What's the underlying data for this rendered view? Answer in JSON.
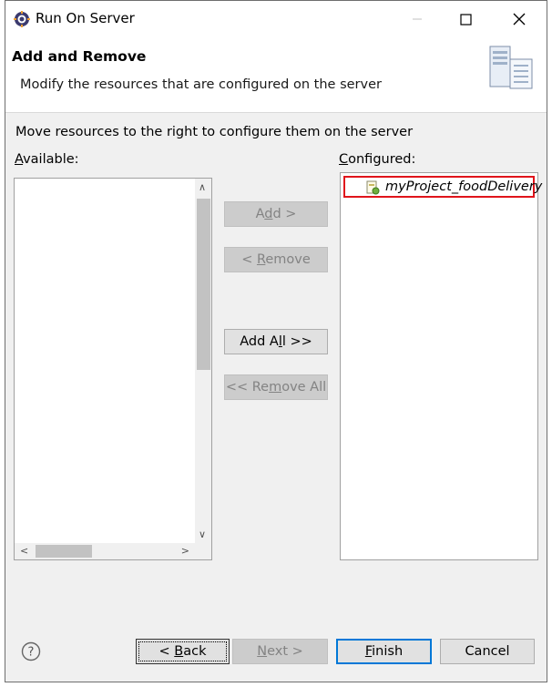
{
  "window": {
    "title": "Run On Server"
  },
  "banner": {
    "title": "Add and Remove",
    "description": "Modify the resources that are configured on the server"
  },
  "instruction": "Move resources to the right to configure them on the server",
  "available": {
    "label_prefix": "",
    "label_mnemonic": "A",
    "label_rest": "vailable:"
  },
  "configured": {
    "label_prefix": "",
    "label_mnemonic": "C",
    "label_rest": "onfigured:",
    "items": [
      {
        "label": "myProject_foodDelivery"
      }
    ]
  },
  "buttons": {
    "add": {
      "pre": "A",
      "mn": "d",
      "post": "d >"
    },
    "remove": {
      "pre": "< ",
      "mn": "R",
      "post": "emove"
    },
    "add_all": {
      "pre": "Add A",
      "mn": "l",
      "post": "l >>"
    },
    "remove_all": {
      "pre": "<< Re",
      "mn": "m",
      "post": "ove All"
    },
    "back": {
      "pre": "< ",
      "mn": "B",
      "post": "ack"
    },
    "next": {
      "pre": "",
      "mn": "N",
      "post": "ext >"
    },
    "finish": {
      "pre": "",
      "mn": "F",
      "post": "inish"
    },
    "cancel": {
      "label": "Cancel"
    }
  },
  "colors": {
    "highlight": "#e0141b",
    "accent": "#0078d7"
  }
}
